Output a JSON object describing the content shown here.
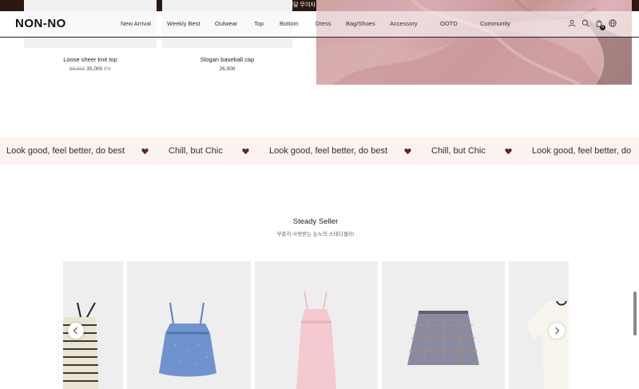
{
  "topbar": {
    "text": "이번달 무이자 할부 카드사 안내"
  },
  "header": {
    "logo": "NON-NO",
    "nav": [
      "New Arrival",
      "Weekly Best",
      "Outwear",
      "Top",
      "Bottom",
      "Dress",
      "Bag/Shoes",
      "Accessory",
      "OOTD",
      "Community"
    ],
    "cart_count": "0"
  },
  "products": [
    {
      "name": "Loose sheer knit top",
      "orig_price": "38,000",
      "price": "35,000",
      "discount": "8%"
    },
    {
      "name": "Slogan baseball cap",
      "price": "26,000"
    }
  ],
  "marquee": {
    "items": [
      "Look good, feel better, do best",
      "Chill, but Chic",
      "Look good, feel better, do best",
      "Chill, but Chic",
      "Look good, feel better, do b"
    ]
  },
  "steady": {
    "title": "Steady Seller",
    "subtitle": "꾸준히 사랑받는 논노의 스테디셀러!"
  },
  "colors": {
    "topbar": "#2b1710",
    "heart": "#5a2a24",
    "marquee_bg": "#fbf3f0"
  }
}
